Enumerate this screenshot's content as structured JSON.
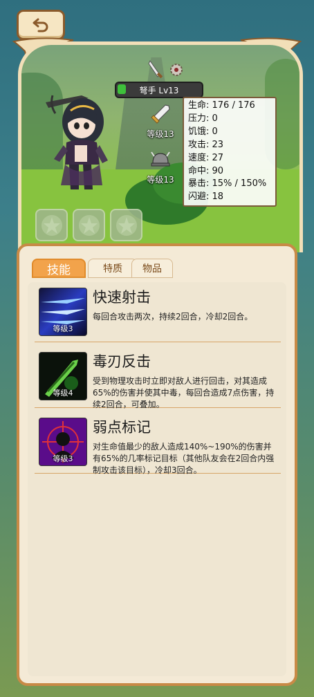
{
  "character": {
    "name_level": "弩手 Lv13",
    "weapon_level": "等级13",
    "armor_level": "等级13"
  },
  "stats": [
    "生命: 176 / 176",
    "压力: 0",
    "饥饿: 0",
    "攻击: 23",
    "速度: 27",
    "命中: 90",
    "暴击: 15% / 150%",
    "闪避: 18"
  ],
  "tabs": [
    "技能",
    "特质",
    "物品"
  ],
  "skills": [
    {
      "name": "快速射击",
      "level": "等级3",
      "desc": "每回合攻击两次，持续2回合，冷却2回合。"
    },
    {
      "name": "毒刃反击",
      "level": "等级4",
      "desc": "受到物理攻击时立即对敌人进行回击，对其造成65%的伤害并使其中毒，每回合造成7点伤害，持续2回合，可叠加。"
    },
    {
      "name": "弱点标记",
      "level": "等级3",
      "desc": "对生命值最少的敌人造成140%~190%的伤害并有65%的几率标记目标（其他队友会在2回合内强制攻击该目标），冷却3回合。"
    }
  ],
  "colors": {
    "panel_border": "#c88a46",
    "active_tab": "#f2a34b",
    "hp_green": "#3ec13b"
  }
}
